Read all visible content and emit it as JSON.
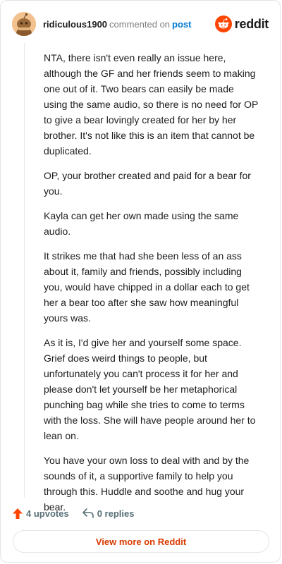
{
  "comment": {
    "username": "ridiculous1900",
    "action_text": "commented on",
    "post_link": "post",
    "brand": "reddit",
    "paragraphs": [
      "NTA, there isn't even really an issue here, although the GF and her friends seem to making one out of it. Two bears can easily be made using the same audio, so there is no need for OP to give a bear lovingly created for her by her brother. It's not like this is an item that cannot be duplicated.",
      "OP, your brother created and paid for a bear for you.",
      "Kayla can get her own made using the same audio.",
      "It strikes me that had she been less of an ass about it, family and friends, possibly including you, would have chipped in a dollar each to get her a bear too after she saw how meaningful yours was.",
      "As it is, I'd give her and yourself some space. Grief does weird things to people, but unfortunately you can't process it for her and please don't let yourself be her metaphorical punching bag while she tries to come to terms with the loss. She will have people around her to lean on.",
      "You have your own loss to deal with and by the sounds of it, a supportive family to help you through this. Huddle and soothe and hug your bear."
    ],
    "upvotes_label": "4 upvotes",
    "replies_label": "0 replies",
    "view_more_label": "View more on Reddit"
  },
  "colors": {
    "brand_orange": "#ff4500",
    "link_blue": "#0079d3",
    "upvote_orange": "#ff4500",
    "view_more": "#d93a00"
  },
  "icons": {
    "avatar": "snoo-avatar-icon",
    "brand": "reddit-logo-icon",
    "upvote": "upvote-arrow-icon",
    "reply": "reply-arrow-icon"
  }
}
